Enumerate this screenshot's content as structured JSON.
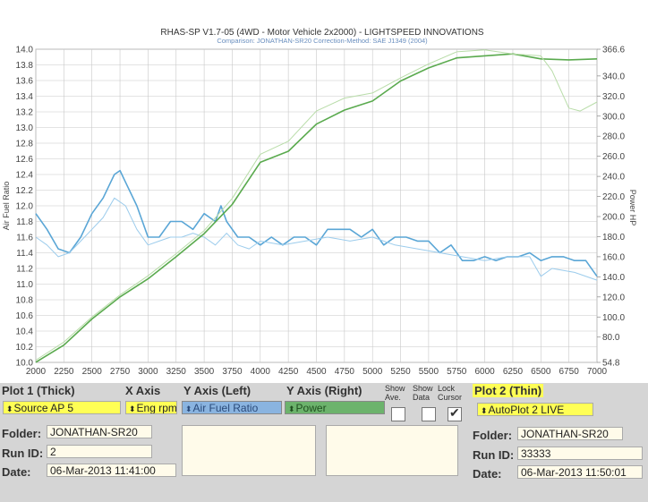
{
  "chart_data": {
    "type": "line",
    "title": "RHAS-SP V1.7-05   (4WD - Motor Vehicle 2x2000) - LIGHTSPEED INNOVATIONS",
    "subtitle": "Comparison: JONATHAN-SR20      Correction-Method: SAE J1349 (2004)",
    "xlabel": "",
    "ylabel_left": "Air Fuel Ratio",
    "ylabel_right": "Power HP",
    "xlim": [
      2000,
      7000
    ],
    "ylim_left": [
      10.0,
      14.0
    ],
    "ylim_right": [
      54.8,
      366.6
    ],
    "x_ticks": [
      "2000",
      "2250",
      "2500",
      "2750",
      "3000",
      "3250",
      "3500",
      "3750",
      "4000",
      "4250",
      "4500",
      "4750",
      "5000",
      "5250",
      "5500",
      "5750",
      "6000",
      "6250",
      "6500",
      "6750",
      "7000"
    ],
    "y_left_ticks": [
      "10.0",
      "10.2",
      "10.4",
      "10.6",
      "10.8",
      "11.0",
      "11.2",
      "11.4",
      "11.6",
      "11.8",
      "12.0",
      "12.2",
      "12.4",
      "12.6",
      "12.8",
      "13.0",
      "13.2",
      "13.4",
      "13.6",
      "13.8",
      "14.0"
    ],
    "y_right_ticks": [
      "54.8",
      "80.0",
      "100.0",
      "120.0",
      "140.0",
      "160.0",
      "180.0",
      "200.0",
      "220.0",
      "240.0",
      "260.0",
      "280.0",
      "300.0",
      "320.0",
      "340.0",
      "366.6"
    ],
    "grid": true,
    "series": [
      {
        "name": "AFR (Thick)",
        "axis": "left",
        "color": "#5aa6d6",
        "x": [
          2000,
          2100,
          2200,
          2300,
          2400,
          2500,
          2600,
          2700,
          2750,
          2800,
          2900,
          3000,
          3100,
          3200,
          3300,
          3400,
          3500,
          3600,
          3650,
          3700,
          3800,
          3900,
          4000,
          4100,
          4200,
          4300,
          4400,
          4500,
          4600,
          4700,
          4800,
          4900,
          5000,
          5100,
          5200,
          5300,
          5400,
          5500,
          5600,
          5700,
          5800,
          5900,
          6000,
          6100,
          6200,
          6300,
          6400,
          6500,
          6600,
          6700,
          6800,
          6900,
          7000
        ],
        "y": [
          11.9,
          11.7,
          11.45,
          11.4,
          11.6,
          11.9,
          12.1,
          12.4,
          12.45,
          12.3,
          12.0,
          11.6,
          11.6,
          11.8,
          11.8,
          11.7,
          11.9,
          11.8,
          12.0,
          11.8,
          11.6,
          11.6,
          11.5,
          11.6,
          11.5,
          11.6,
          11.6,
          11.5,
          11.7,
          11.7,
          11.7,
          11.6,
          11.7,
          11.5,
          11.6,
          11.6,
          11.55,
          11.55,
          11.4,
          11.5,
          11.3,
          11.3,
          11.35,
          11.3,
          11.35,
          11.35,
          11.4,
          11.3,
          11.35,
          11.35,
          11.3,
          11.3,
          11.1
        ]
      },
      {
        "name": "AFR (Thin)",
        "axis": "left",
        "color": "#9cccec",
        "x": [
          2000,
          2100,
          2200,
          2300,
          2400,
          2500,
          2600,
          2700,
          2800,
          2900,
          3000,
          3100,
          3200,
          3300,
          3400,
          3500,
          3600,
          3700,
          3800,
          3900,
          4000,
          4200,
          4400,
          4600,
          4800,
          5000,
          5200,
          5400,
          5600,
          5800,
          6000,
          6200,
          6400,
          6500,
          6600,
          6800,
          7000
        ],
        "y": [
          11.6,
          11.5,
          11.35,
          11.4,
          11.55,
          11.7,
          11.85,
          12.1,
          12.0,
          11.7,
          11.5,
          11.55,
          11.6,
          11.6,
          11.65,
          11.6,
          11.5,
          11.65,
          11.5,
          11.45,
          11.55,
          11.5,
          11.55,
          11.6,
          11.55,
          11.6,
          11.5,
          11.45,
          11.4,
          11.35,
          11.3,
          11.35,
          11.35,
          11.1,
          11.2,
          11.15,
          11.05
        ]
      },
      {
        "name": "Power (Thick)",
        "axis": "right",
        "color": "#5aaa4e",
        "x": [
          2000,
          2250,
          2500,
          2750,
          3000,
          3250,
          3500,
          3750,
          4000,
          4250,
          4500,
          4750,
          5000,
          5250,
          5500,
          5750,
          6000,
          6250,
          6500,
          6750,
          7000
        ],
        "y": [
          55,
          72,
          98,
          120,
          138,
          160,
          183,
          212,
          254,
          265,
          292,
          306,
          315,
          335,
          348,
          358,
          360,
          362,
          357,
          356,
          357
        ]
      },
      {
        "name": "Power (Thin)",
        "axis": "right",
        "color": "#b8dca8",
        "x": [
          2000,
          2250,
          2500,
          2750,
          3000,
          3250,
          3500,
          3750,
          4000,
          4250,
          4500,
          4750,
          5000,
          5250,
          5500,
          5750,
          6000,
          6250,
          6500,
          6600,
          6750,
          6850,
          7000
        ],
        "y": [
          57,
          75,
          100,
          122,
          141,
          163,
          186,
          218,
          262,
          275,
          305,
          318,
          323,
          338,
          352,
          364,
          366,
          362,
          360,
          345,
          308,
          305,
          314
        ]
      }
    ]
  },
  "panel": {
    "plot1_label": "Plot 1 (Thick)",
    "xaxis_label": "X Axis",
    "yaxis_left_label": "Y Axis (Left)",
    "yaxis_right_label": "Y Axis (Right)",
    "show_ave": "Show Ave.",
    "show_data": "Show Data",
    "lock_cursor": "Lock Cursor",
    "plot2_label": "Plot 2 (Thin)",
    "source": "Source AP 5",
    "xaxis_value": "Eng rpm",
    "yaxis_left_value": "Air Fuel Ratio",
    "yaxis_right_value": "Power",
    "plot2_value": "AutoPlot 2 LIVE",
    "folder_label": "Folder:",
    "runid_label": "Run ID:",
    "date_label": "Date:",
    "left": {
      "folder": "JONATHAN-SR20",
      "runid": "2",
      "date": "06-Mar-2013  11:41:00"
    },
    "right": {
      "folder": "JONATHAN-SR20",
      "runid": "33333",
      "date": "06-Mar-2013  11:50:01"
    }
  },
  "colors": {
    "grid": "#c8c8c8",
    "axis_text": "#444444",
    "panel_bg": "#d5d5d5"
  }
}
